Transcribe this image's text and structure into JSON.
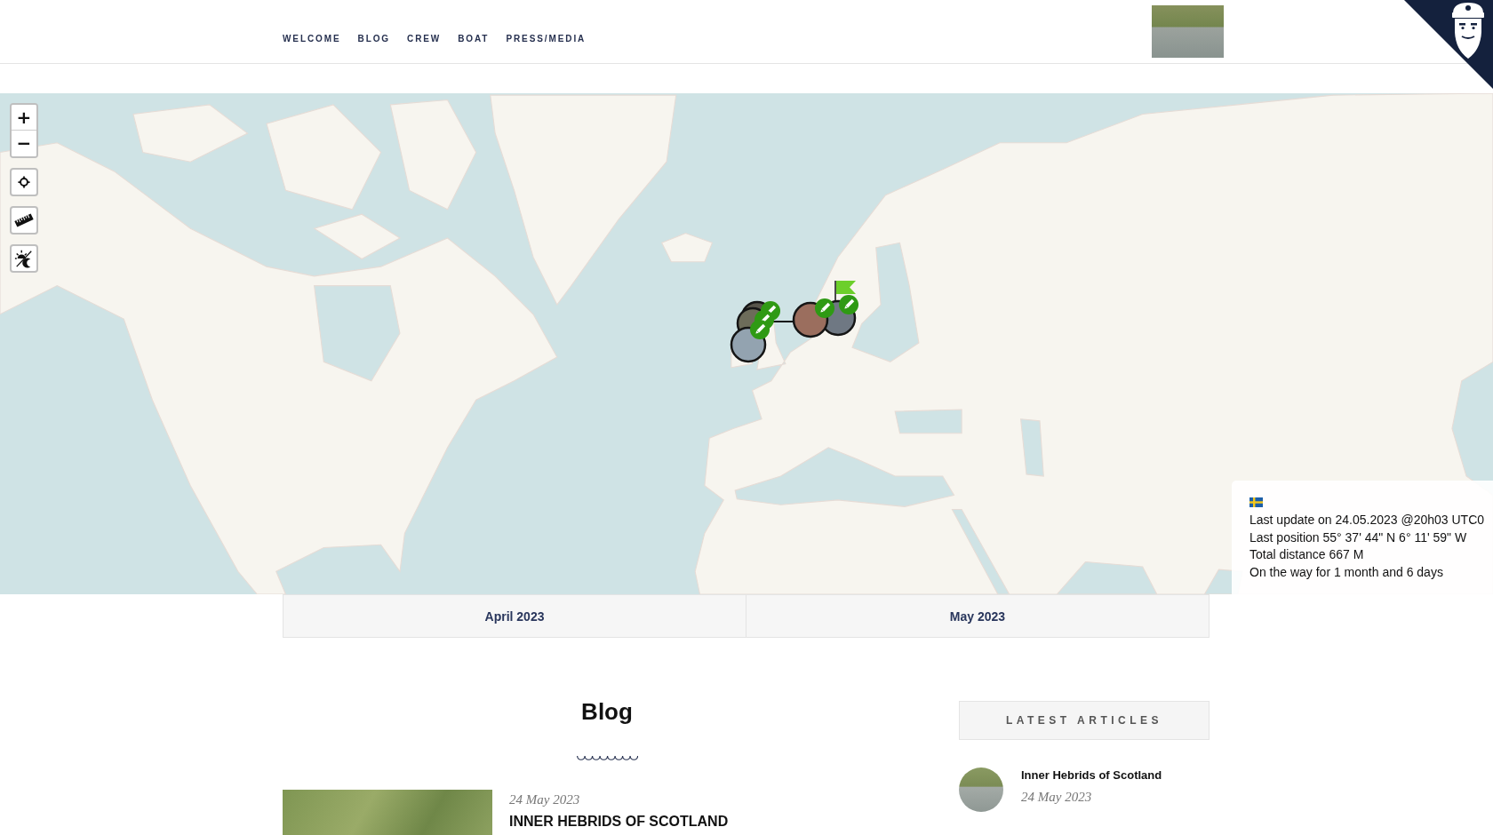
{
  "header": {
    "nav": [
      {
        "label": "WELCOME"
      },
      {
        "label": "BLOG"
      },
      {
        "label": "CREW"
      },
      {
        "label": "BOAT"
      },
      {
        "label": "PRESS/MEDIA"
      }
    ]
  },
  "map": {
    "zoom_in": "+",
    "zoom_out": "−",
    "status": {
      "lines": [
        "Last update on 24.05.2023 @20h03 UTC0",
        "Last position 55° 37' 44\" N 6° 11' 59\" W",
        "Total distance 667 M",
        "On the way for 1 month and 6 days"
      ]
    }
  },
  "months": [
    {
      "label": "April 2023",
      "selected": false
    },
    {
      "label": "May 2023",
      "selected": false
    }
  ],
  "blog": {
    "title": "Blog",
    "posts": [
      {
        "date": "24 May 2023",
        "title": "INNER HEBRIDS OF SCOTLAND"
      }
    ]
  },
  "sidebar": {
    "title": "LATEST ARTICLES",
    "articles": [
      {
        "title": "Inner Hebrids of Scotland",
        "date": "24 May 2023"
      }
    ]
  }
}
